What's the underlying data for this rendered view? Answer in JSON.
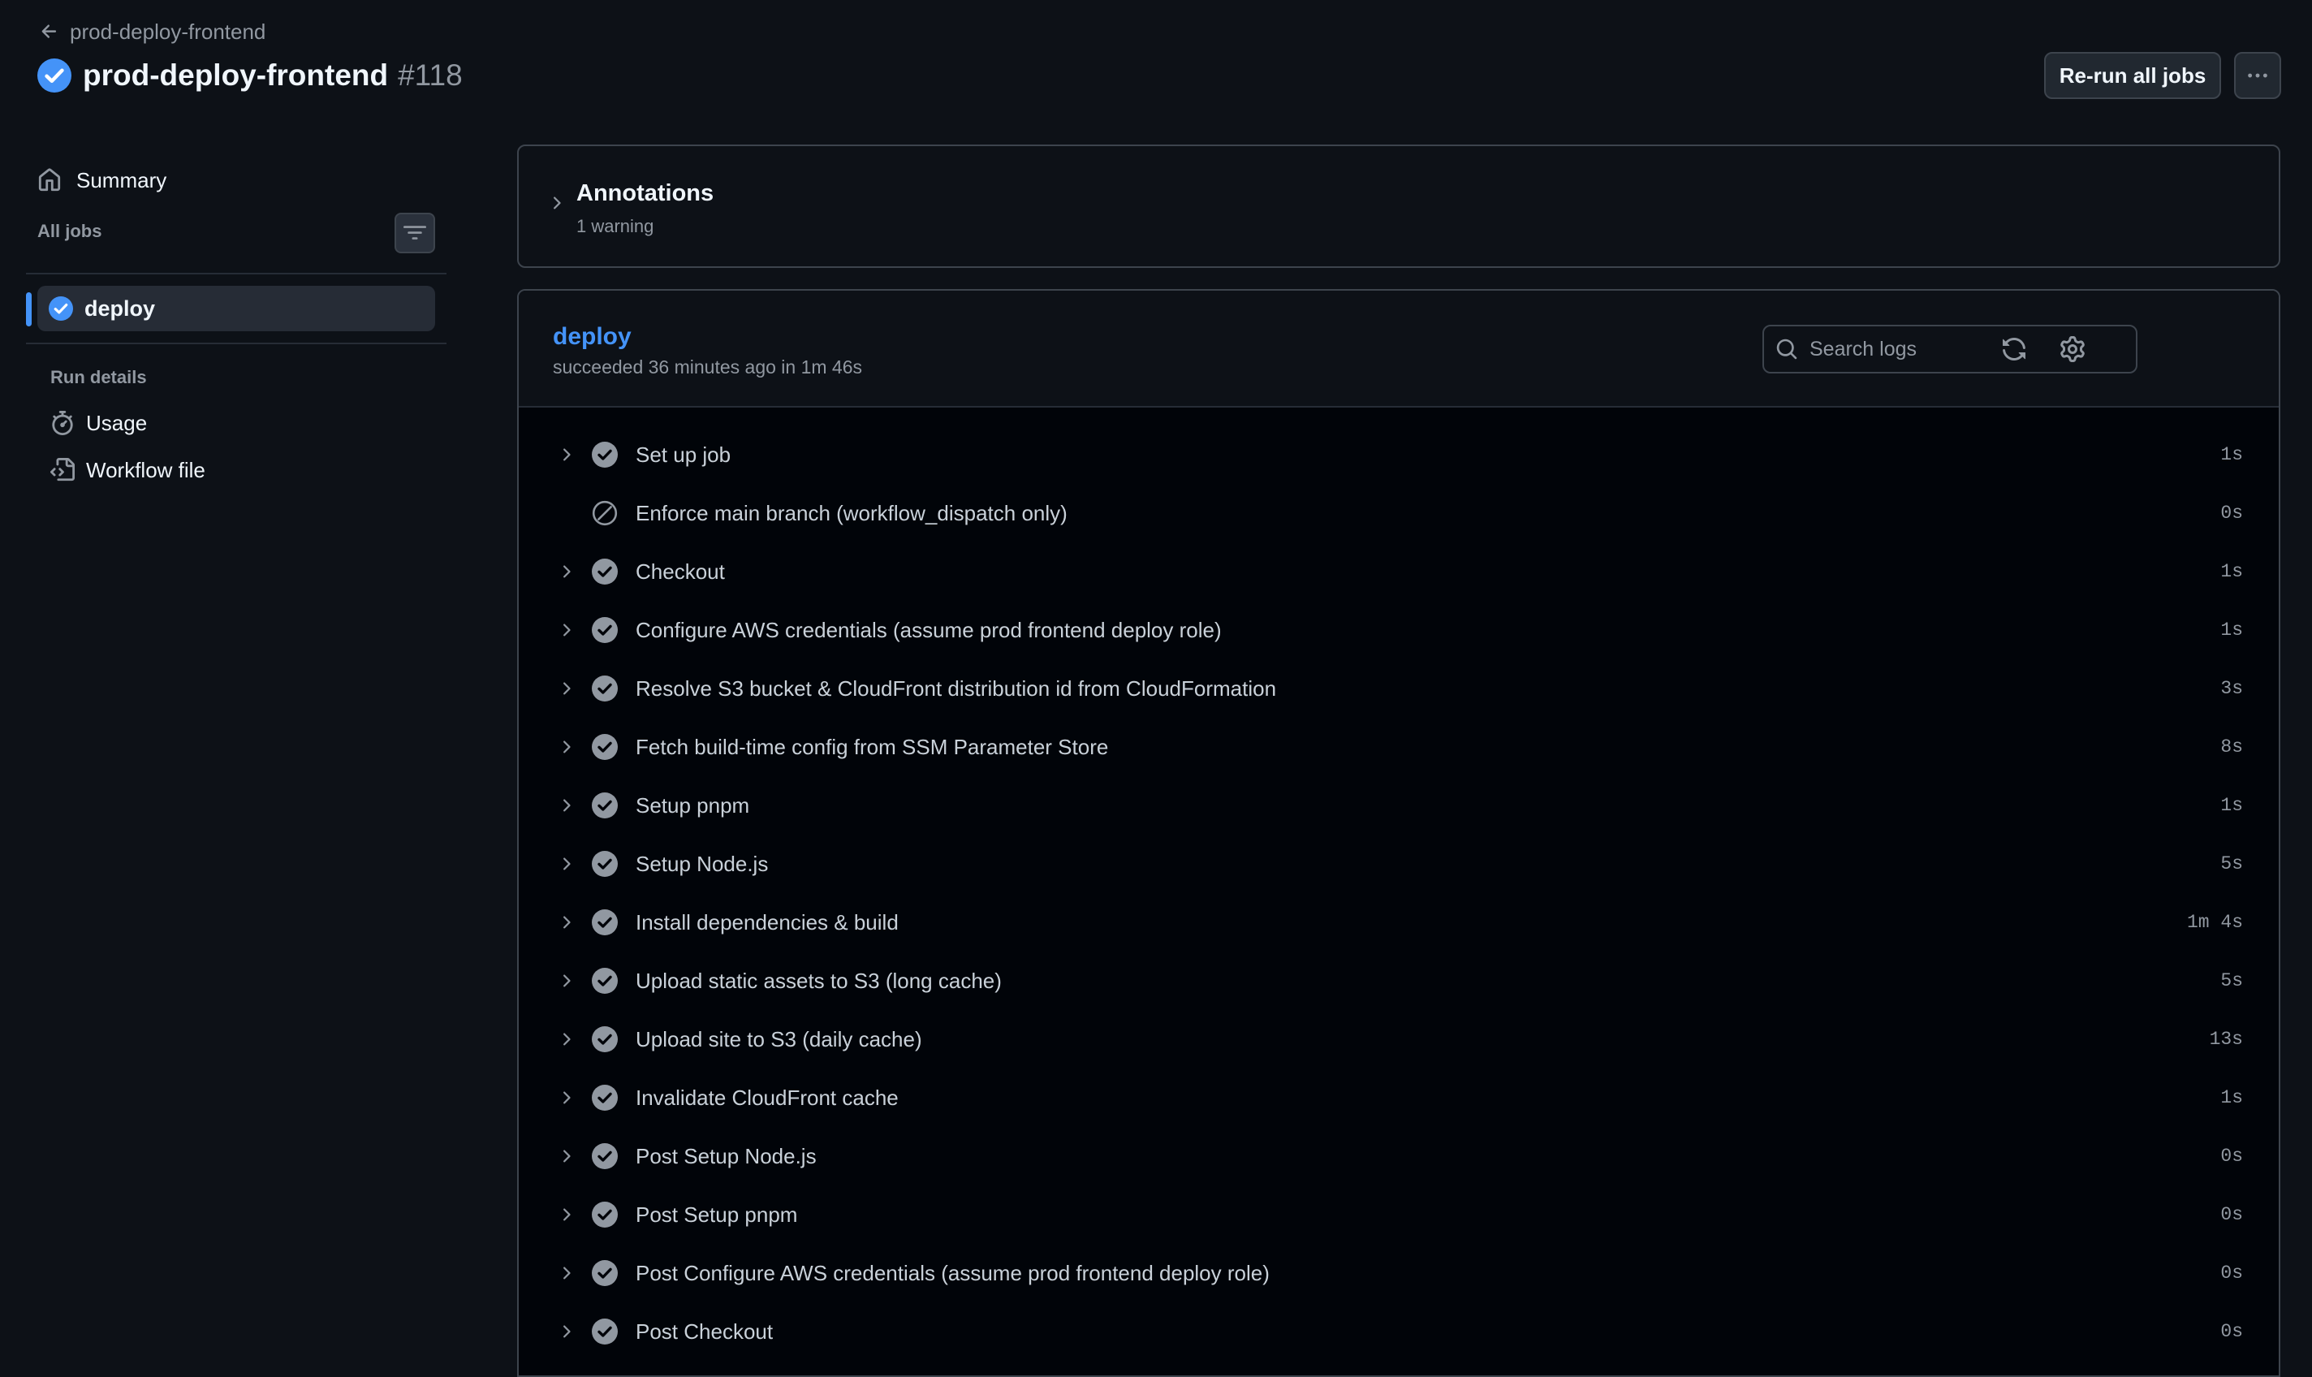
{
  "header": {
    "back_label": "prod-deploy-frontend",
    "workflow_name": "prod-deploy-frontend",
    "run_number": "#118",
    "rerun_label": "Re-run all jobs"
  },
  "sidebar": {
    "summary_label": "Summary",
    "all_jobs_label": "All jobs",
    "job_label": "deploy",
    "run_details_label": "Run details",
    "usage_label": "Usage",
    "workflow_file_label": "Workflow file"
  },
  "annotations": {
    "title": "Annotations",
    "subtitle": "1 warning"
  },
  "job": {
    "name": "deploy",
    "status": "succeeded 36 minutes ago in 1m 46s",
    "search_placeholder": "Search logs",
    "steps": [
      {
        "name": "Set up job",
        "duration": "1s",
        "state": "success"
      },
      {
        "name": "Enforce main branch (workflow_dispatch only)",
        "duration": "0s",
        "state": "skipped"
      },
      {
        "name": "Checkout",
        "duration": "1s",
        "state": "success"
      },
      {
        "name": "Configure AWS credentials (assume prod frontend deploy role)",
        "duration": "1s",
        "state": "success"
      },
      {
        "name": "Resolve S3 bucket & CloudFront distribution id from CloudFormation",
        "duration": "3s",
        "state": "success"
      },
      {
        "name": "Fetch build-time config from SSM Parameter Store",
        "duration": "8s",
        "state": "success"
      },
      {
        "name": "Setup pnpm",
        "duration": "1s",
        "state": "success"
      },
      {
        "name": "Setup Node.js",
        "duration": "5s",
        "state": "success"
      },
      {
        "name": "Install dependencies & build",
        "duration": "1m 4s",
        "state": "success"
      },
      {
        "name": "Upload static assets to S3 (long cache)",
        "duration": "5s",
        "state": "success"
      },
      {
        "name": "Upload site to S3 (daily cache)",
        "duration": "13s",
        "state": "success"
      },
      {
        "name": "Invalidate CloudFront cache",
        "duration": "1s",
        "state": "success"
      },
      {
        "name": "Post Setup Node.js",
        "duration": "0s",
        "state": "success"
      },
      {
        "name": "Post Setup pnpm",
        "duration": "0s",
        "state": "success"
      },
      {
        "name": "Post Configure AWS credentials (assume prod frontend deploy role)",
        "duration": "0s",
        "state": "success"
      },
      {
        "name": "Post Checkout",
        "duration": "0s",
        "state": "success"
      }
    ]
  },
  "colors": {
    "background": "#0d1117",
    "accent": "#4493f8",
    "success_icon": "#9198a1",
    "border": "#3d444d"
  }
}
